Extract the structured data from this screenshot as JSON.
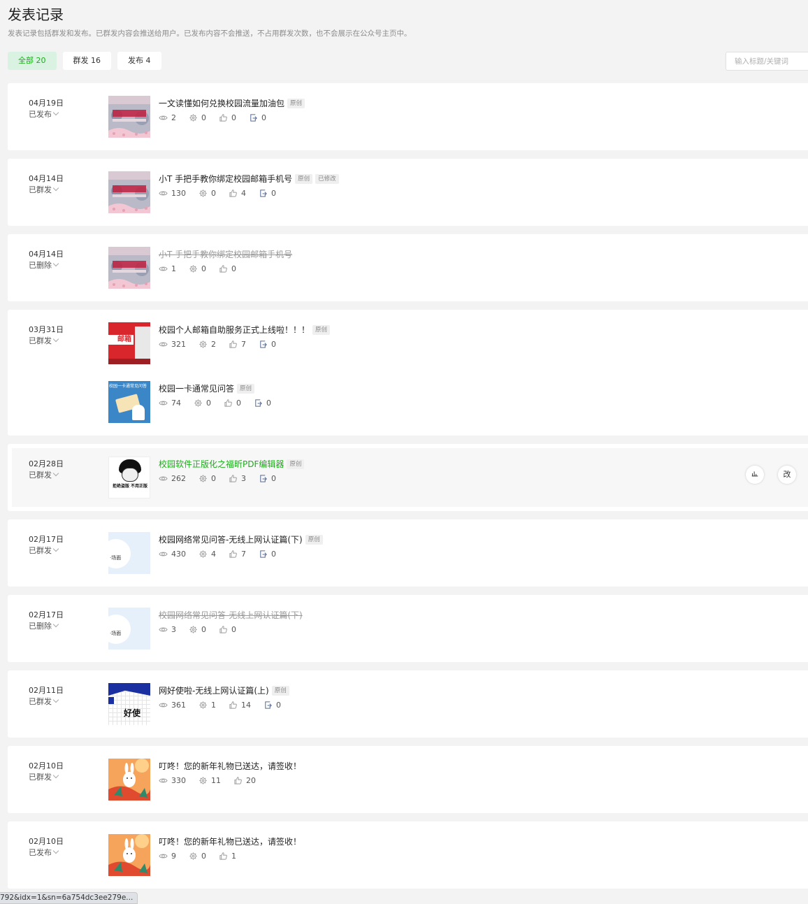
{
  "header": {
    "title": "发表记录",
    "description": "发表记录包括群发和发布。已群发内容会推送给用户。已发布内容不会推送，不占用群发次数，也不会展示在公众号主页中。"
  },
  "tabs": [
    {
      "label": "全部 20",
      "active": true
    },
    {
      "label": "群发 16",
      "active": false
    },
    {
      "label": "发布 4",
      "active": false
    }
  ],
  "search": {
    "placeholder": "输入标题/关键词"
  },
  "colors": {
    "accent": "#1aad19",
    "tab_active_bg": "#d9f2e2"
  },
  "records": [
    {
      "date": "04月19日",
      "status": "已发布",
      "articles": [
        {
          "title": "一文读懂如何兑换校园流量加油包",
          "tags": [
            "原创"
          ],
          "thumb": "mail-banner",
          "views": "2",
          "shares": "0",
          "likes": "0",
          "forwards": "0"
        }
      ]
    },
    {
      "date": "04月14日",
      "status": "已群发",
      "articles": [
        {
          "title": "小T 手把手教你绑定校园邮箱手机号",
          "tags": [
            "原创",
            "已修改"
          ],
          "thumb": "mail-banner",
          "views": "130",
          "shares": "0",
          "likes": "4",
          "forwards": "0"
        }
      ]
    },
    {
      "date": "04月14日",
      "status": "已删除",
      "articles": [
        {
          "title": "小T 手把手教你绑定校园邮箱手机号",
          "tags": [],
          "deleted": true,
          "thumb": "mail-banner",
          "views": "1",
          "shares": "0",
          "likes": "0"
        }
      ]
    },
    {
      "date": "03月31日",
      "status": "已群发",
      "articles": [
        {
          "title": "校园个人邮箱自助服务正式上线啦！！！",
          "tags": [
            "原创"
          ],
          "thumb": "red-mail",
          "thumb_text": "邮箱",
          "views": "321",
          "shares": "2",
          "likes": "7",
          "forwards": "0"
        },
        {
          "title": "校园一卡通常见问答",
          "tags": [
            "原创"
          ],
          "thumb": "card-qa",
          "thumb_text": "校园一卡通常见问答",
          "views": "74",
          "shares": "0",
          "likes": "0",
          "forwards": "0"
        }
      ]
    },
    {
      "date": "02月28日",
      "status": "已群发",
      "hovered": true,
      "articles": [
        {
          "title": "校园软件正版化之福昕PDF编辑器",
          "tags": [
            "原创"
          ],
          "link": true,
          "thumb": "meme",
          "thumb_text": "拒绝盗版 不用正版",
          "views": "262",
          "shares": "0",
          "likes": "3",
          "forwards": "0"
        }
      ],
      "actions": [
        "stats-icon",
        "改"
      ]
    },
    {
      "date": "02月17日",
      "status": "已群发",
      "articles": [
        {
          "title": "校园网络常见问答-无线上网认证篇(下)",
          "tags": [
            "原创"
          ],
          "thumb": "network",
          "thumb_text": "场面",
          "views": "430",
          "shares": "4",
          "likes": "7",
          "forwards": "0"
        }
      ]
    },
    {
      "date": "02月17日",
      "status": "已删除",
      "articles": [
        {
          "title": "校园网络常见问答-无线上网认证篇(下)",
          "tags": [],
          "deleted": true,
          "thumb": "network",
          "thumb_text": "场面",
          "views": "3",
          "shares": "0",
          "likes": "0"
        }
      ]
    },
    {
      "date": "02月11日",
      "status": "已群发",
      "articles": [
        {
          "title": "网好使啦-无线上网认证篇(上)",
          "tags": [
            "原创"
          ],
          "thumb": "grid",
          "thumb_text": "好使",
          "views": "361",
          "shares": "1",
          "likes": "14",
          "forwards": "0"
        }
      ]
    },
    {
      "date": "02月10日",
      "status": "已群发",
      "articles": [
        {
          "title": "叮咚！您的新年礼物已送达，请签收！",
          "tags": [],
          "thumb": "rabbit",
          "views": "330",
          "shares": "11",
          "likes": "20"
        }
      ]
    },
    {
      "date": "02月10日",
      "status": "已发布",
      "articles": [
        {
          "title": "叮咚！您的新年礼物已送达，请签收！",
          "tags": [],
          "thumb": "rabbit",
          "views": "9",
          "shares": "0",
          "likes": "1"
        }
      ]
    }
  ],
  "status_bar": {
    "url": "792&idx=1&sn=6a754dc3ee279e..."
  }
}
